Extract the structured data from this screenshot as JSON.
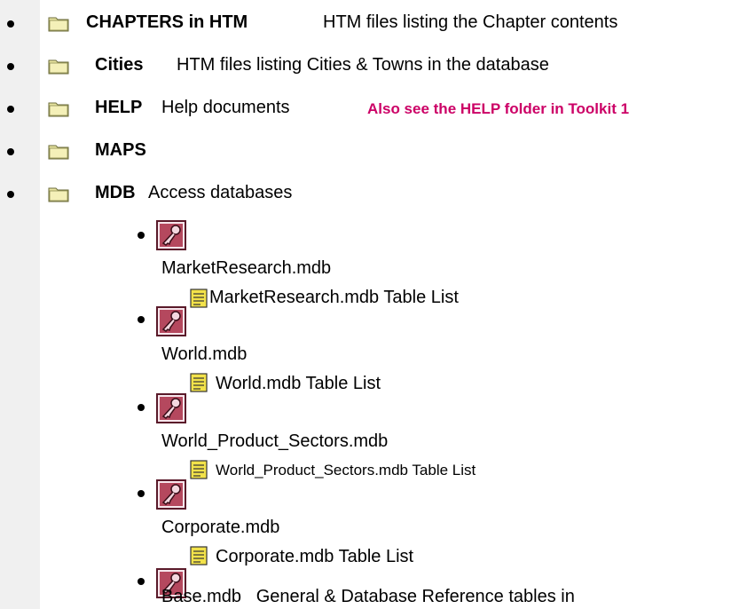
{
  "folders": [
    {
      "name": "CHAPTERS in HTM",
      "desc": "HTM files listing the Chapter contents",
      "note": ""
    },
    {
      "name": "Cities",
      "desc": "HTM files listing Cities & Towns in the database",
      "note": ""
    },
    {
      "name": "HELP",
      "desc": "Help documents",
      "note": "Also see the HELP folder in Toolkit 1"
    },
    {
      "name": "MAPS",
      "desc": "",
      "note": ""
    },
    {
      "name": "MDB",
      "desc": "Access databases",
      "note": ""
    }
  ],
  "databases": [
    {
      "file": "MarketResearch.mdb",
      "table_list": "MarketResearch.mdb Table List"
    },
    {
      "file": "World.mdb",
      "table_list": "World.mdb Table List"
    },
    {
      "file": "World_Product_Sectors.mdb",
      "table_list": "World_Product_Sectors.mdb Table List"
    },
    {
      "file": "Corporate.mdb",
      "table_list": "Corporate.mdb Table List"
    },
    {
      "file": "Base.mdb   General & Database Reference tables in",
      "table_list": ""
    }
  ],
  "colors": {
    "note": "#cc0066",
    "folder": "#e8e4a0",
    "access": "#8b1a3a",
    "doc": "#f2e24a"
  }
}
